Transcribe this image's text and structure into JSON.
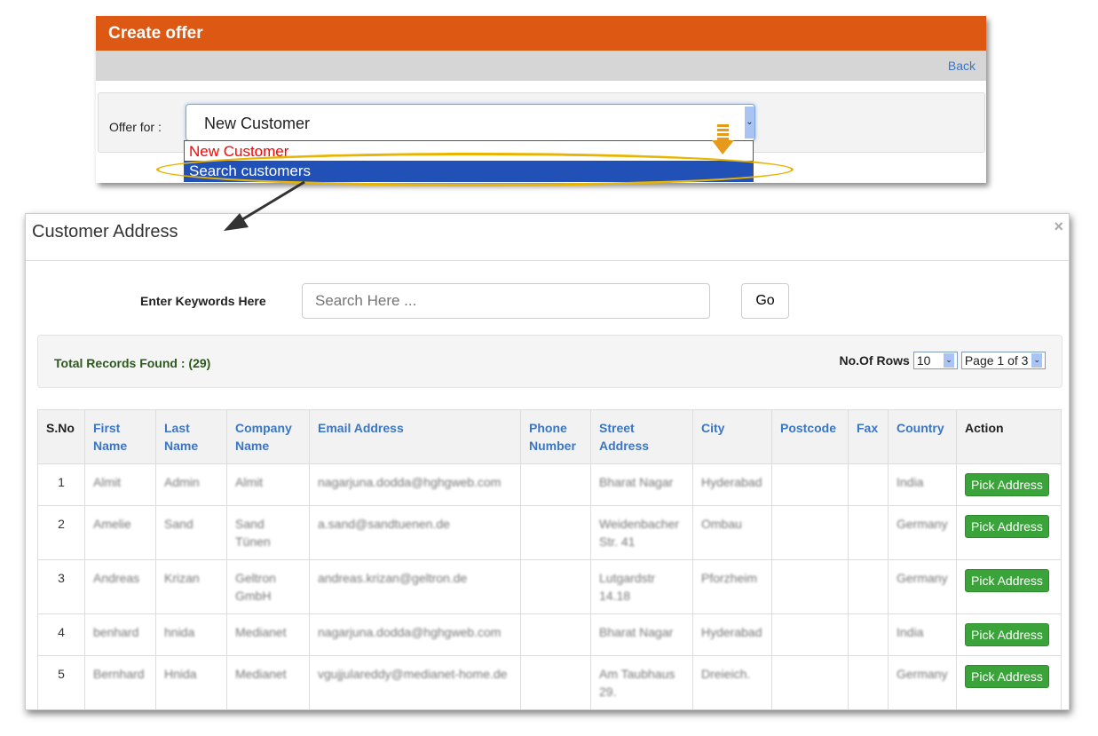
{
  "panel": {
    "title": "Create offer",
    "back": "Back",
    "offer_label": "Offer for :",
    "selected": "New Customer",
    "options": [
      "New Customer",
      "Search customers"
    ]
  },
  "modal": {
    "title": "Customer Address",
    "close": "×",
    "keywords_label": "Enter Keywords Here",
    "search_placeholder": "Search Here ...",
    "go": "Go",
    "total": "Total Records Found : (29)",
    "rows_label": "No.Of Rows",
    "rows_value": "10",
    "page_value": "Page 1 of 3",
    "columns": [
      "S.No",
      "First Name",
      "Last Name",
      "Company Name",
      "Email Address",
      "Phone Number",
      "Street Address",
      "City",
      "Postcode",
      "Fax",
      "Country",
      "Action"
    ],
    "action_label": "Pick Address",
    "rows": [
      [
        "1",
        "Almit",
        "Admin",
        "Almit",
        "nagarjuna.dodda@hghgweb.com",
        "",
        "Bharat Nagar",
        "Hyderabad",
        "",
        "",
        "India"
      ],
      [
        "2",
        "Amelie",
        "Sand",
        "Sand Tünen",
        "a.sand@sandtuenen.de",
        "",
        "Weidenbacher Str. 41",
        "Ombau",
        "",
        "",
        "Germany"
      ],
      [
        "3",
        "Andreas",
        "Krizan",
        "Geltron GmbH",
        "andreas.krizan@geltron.de",
        "",
        "Lutgardstr 14.18",
        "Pforzheim",
        "",
        "",
        "Germany"
      ],
      [
        "4",
        "benhard",
        "hnida",
        "Medianet",
        "nagarjuna.dodda@hghgweb.com",
        "",
        "Bharat Nagar",
        "Hyderabad",
        "",
        "",
        "India"
      ],
      [
        "5",
        "Bernhard",
        "Hnida",
        "Medianet",
        "vgujjulareddy@medianet-home.de",
        "",
        "Am Taubhaus 29.",
        "Dreieich.",
        "",
        "",
        "Germany"
      ]
    ]
  },
  "colors": {
    "header": "#dd5812",
    "highlight": "#2150b6",
    "annotation": "#e9b400",
    "button": "#3aa33a"
  }
}
